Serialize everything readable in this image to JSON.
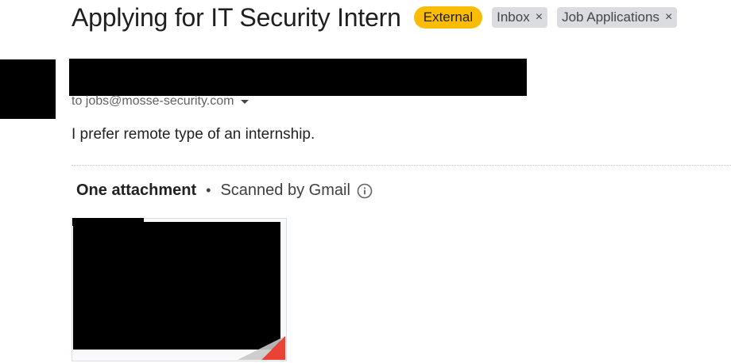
{
  "email": {
    "subject": "Applying for IT Security Intern",
    "labels": [
      {
        "name": "External",
        "removable": false,
        "color": "#fbbc04"
      },
      {
        "name": "Inbox",
        "removable": true
      },
      {
        "name": "Job Applications",
        "removable": true
      }
    ],
    "to": "to jobs@mosse-security.com",
    "body": "I prefer remote type of an internship."
  },
  "attachments": {
    "count_label": "One attachment",
    "separator": "•",
    "scan_status": "Scanned by Gmail"
  },
  "icons": {
    "label_remove": "close-icon",
    "to_details": "chevron-down-icon",
    "scan_info": "info-icon"
  },
  "colors": {
    "external_label": "#fbbc04",
    "label_bg": "#dadce0",
    "attachment_fold_accent": "#ea4335"
  }
}
